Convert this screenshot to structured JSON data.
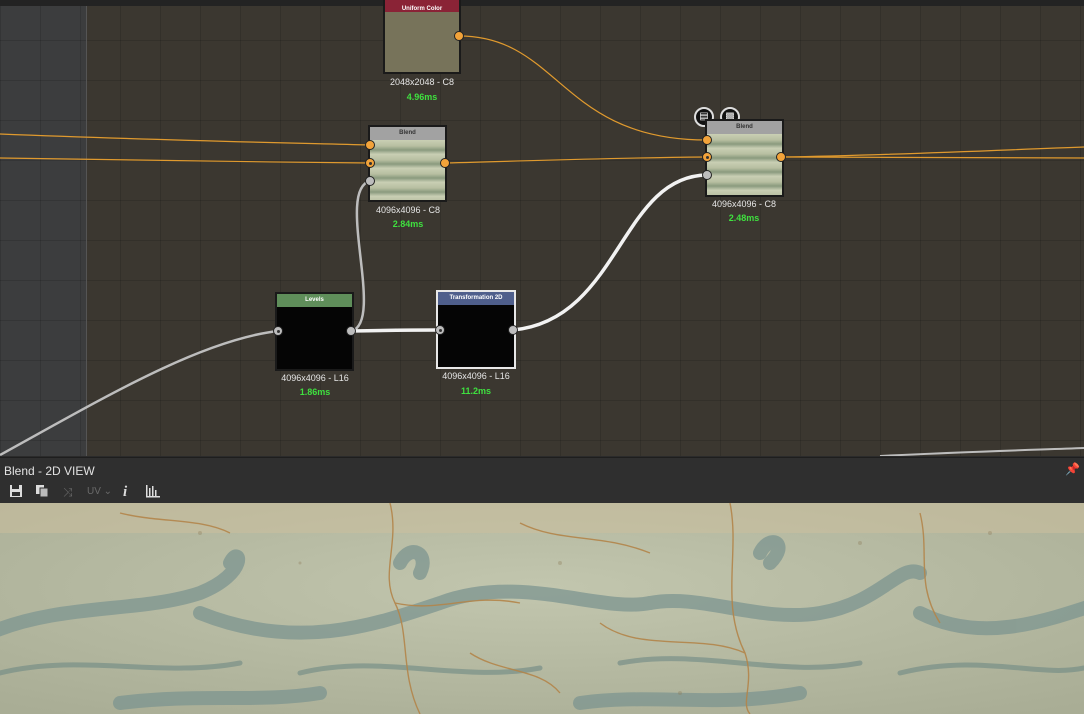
{
  "panel": {
    "title": "Blend - 2D VIEW"
  },
  "toolbar": {
    "uv_label": "UV",
    "info_label": "i"
  },
  "nodes": {
    "uniform": {
      "title": "Uniform Color",
      "res": "2048x2048 - C8",
      "time": "4.96ms"
    },
    "blend1": {
      "title": "Blend",
      "res": "4096x4096 - C8",
      "time": "2.84ms"
    },
    "blend2": {
      "title": "Blend",
      "res": "4096x4096 - C8",
      "time": "2.48ms"
    },
    "levels": {
      "title": "Levels",
      "res": "4096x4096 - L16",
      "time": "1.86ms"
    },
    "transform": {
      "title": "Transformation 2D",
      "res": "4096x4096 - L16",
      "time": "11.2ms"
    }
  },
  "colors": {
    "wire_orange": "#e09a2e",
    "wire_white": "#f2f2f2",
    "time_green": "#3fe03f",
    "levels_header": "#5f8e5a",
    "transform_header": "#4f5f8c",
    "uniform_header": "#8a2336"
  },
  "icons": [
    "save-icon",
    "copy-icon",
    "share-icon",
    "info-icon",
    "histogram-icon",
    "pin-icon",
    "document-icon",
    "checker-icon"
  ]
}
